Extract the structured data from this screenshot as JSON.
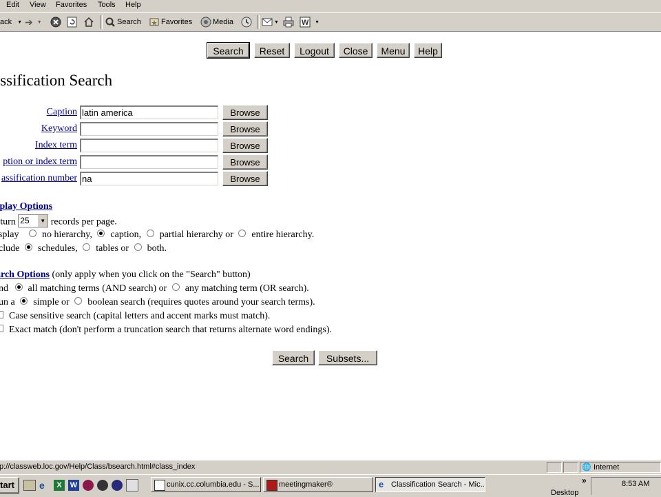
{
  "menubar": {
    "items": [
      "Edit",
      "View",
      "Favorites",
      "Tools",
      "Help"
    ]
  },
  "toolbar": {
    "back_label": "ack",
    "search_label": "Search",
    "favorites_label": "Favorites",
    "media_label": "Media"
  },
  "top_buttons": [
    "Search",
    "Reset",
    "Logout",
    "Close",
    "Menu",
    "Help"
  ],
  "page_title": "assification Search",
  "fields": [
    {
      "label": "Caption",
      "value": "latin america"
    },
    {
      "label": "Keyword",
      "value": ""
    },
    {
      "label": "Index term",
      "value": ""
    },
    {
      "label": "ption or index term",
      "value": ""
    },
    {
      "label": "assification number",
      "value": "na"
    }
  ],
  "browse_label": "Browse",
  "display_options": {
    "heading": "splay Options",
    "return_prefix": "eturn",
    "records_value": "25",
    "return_suffix": "records per page.",
    "display_prefix": "isplay",
    "display_opts": [
      "no hierarchy,",
      "caption,",
      "partial hierarchy or",
      "entire hierarchy."
    ],
    "display_selected": 1,
    "include_prefix": "clude",
    "include_opts": [
      "schedules,",
      "tables or",
      "both."
    ],
    "include_selected": 0
  },
  "search_options": {
    "heading": "arch Options",
    "note": " (only apply when you click on the \"Search\" button)",
    "find_prefix": "nd",
    "find_opts": [
      "all matching terms (AND search) or",
      "any matching term (OR search)."
    ],
    "find_selected": 0,
    "run_prefix": "un a",
    "run_opts": [
      "simple or",
      "boolean search (requires quotes around your search terms)."
    ],
    "run_selected": 0,
    "case_label": "Case sensitive search (capital letters and accent marks must match).",
    "exact_label": "Exact match (don't perform a truncation search that returns alternate word endings)."
  },
  "bottom_buttons": [
    "Search",
    "Subsets..."
  ],
  "statusbar": {
    "url": "tp://classweb.loc.gov/Help/Class/bsearch.html#class_index",
    "zone": "Internet"
  },
  "taskbar": {
    "start": "start",
    "tasks": [
      "cunix.cc.columbia.edu - S...",
      "meetingmaker®",
      "Classification Search - Mic..."
    ],
    "desktop": "Desktop",
    "clock": "8:53 AM"
  }
}
